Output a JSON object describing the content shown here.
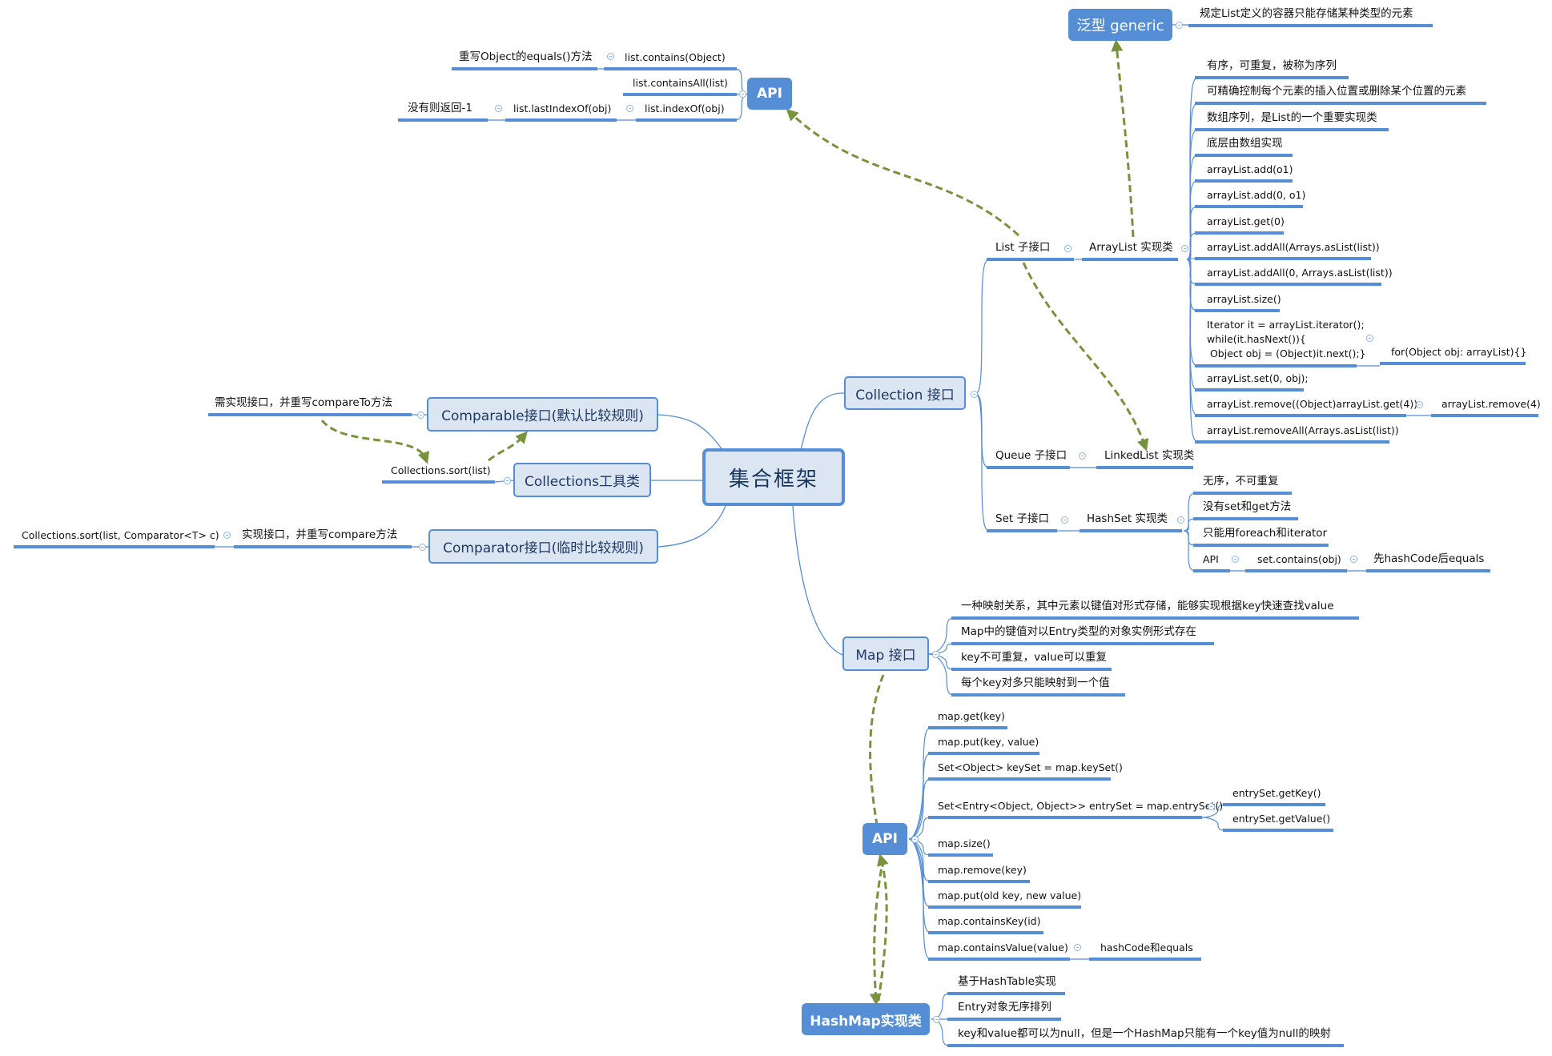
{
  "central": {
    "label": "集合框架"
  },
  "colors": {
    "line": "#558ed5",
    "topic_fill": "#dce6f2",
    "dark_fill": "#558ed5",
    "relation_arrow": "#77933c"
  },
  "collection": {
    "label": "Collection 接口",
    "list": {
      "label": "List 子接口",
      "arraylist": {
        "label": "ArrayList 实现类",
        "items": [
          "有序，可重复，被称为序列",
          "可精确控制每个元素的插入位置或删除某个位置的元素",
          "数组序列，是List的一个重要实现类",
          "底层由数组实现",
          "arrayList.add(o1)",
          "arrayList.add(0, o1)",
          "arrayList.get(0)",
          "arrayList.addAll(Arrays.asList(list))",
          "arrayList.addAll(0, Arrays.asList(list))",
          "arrayList.size()",
          "Iterator it = arrayList.iterator();\nwhile(it.hasNext()){\n Object obj = (Object)it.next();}",
          "arrayList.set(0, obj);",
          "arrayList.remove((Object)arrayList.get(4))",
          "arrayList.removeAll(Arrays.asList(list))"
        ],
        "iterator_alt": "for(Object obj: arrayList){}",
        "remove_alt": "arrayList.remove(4)"
      }
    },
    "queue": {
      "label": "Queue 子接口",
      "linkedlist": {
        "label": "LinkedList 实现类"
      }
    },
    "set": {
      "label": "Set 子接口",
      "hashset": {
        "label": "HashSet 实现类",
        "items": [
          "无序，不可重复",
          "没有set和get方法",
          "只能用foreach和iterator"
        ],
        "api": {
          "label": "API",
          "contains": "set.contains(obj)",
          "contains_note": "先hashCode后equals"
        }
      }
    }
  },
  "generic": {
    "label": "泛型 generic",
    "note": "规定List定义的容器只能存储某种类型的元素"
  },
  "list_api": {
    "label": "API",
    "contains": "list.contains(Object)",
    "contains_note": "重写Object的equals()方法",
    "containsAll": "list.containsAll(list)",
    "indexOf": "list.indexOf(obj)",
    "lastIndexOf": "list.lastIndexOf(obj)",
    "lastIndexOf_note": "没有则返回-1"
  },
  "comparable": {
    "label": "Comparable接口(默认比较规则)",
    "note": "需实现接口，并重写compareTo方法"
  },
  "collections_util": {
    "label": "Collections工具类",
    "sort": "Collections.sort(list)"
  },
  "comparator": {
    "label": "Comparator接口(临时比较规则)",
    "note": "实现接口，并重写compare方法",
    "sort": "Collections.sort(list, Comparator<T> c)"
  },
  "map": {
    "label": "Map 接口",
    "items": [
      "一种映射关系，其中元素以键值对形式存储，能够实现根据key快速查找value",
      "Map中的键值对以Entry类型的对象实例形式存在",
      "key不可重复，value可以重复",
      "每个key对多只能映射到一个值"
    ],
    "api": {
      "label": "API",
      "items": [
        "map.get(key)",
        "map.put(key, value)",
        "Set<Object> keySet = map.keySet()",
        "Set<Entry<Object, Object>> entrySet = map.entrySet()",
        "map.size()",
        "map.remove(key)",
        "map.put(old key, new value)",
        "map.containsKey(id)",
        "map.containsValue(value)"
      ],
      "entry_children": [
        "entrySet.getKey()",
        "entrySet.getValue()"
      ],
      "containsValue_note": "hashCode和equals"
    },
    "hashmap": {
      "label": "HashMap实现类",
      "items": [
        "基于HashTable实现",
        "Entry对象无序排列",
        "key和value都可以为null，但是一个HashMap只能有一个key值为null的映射"
      ]
    }
  }
}
